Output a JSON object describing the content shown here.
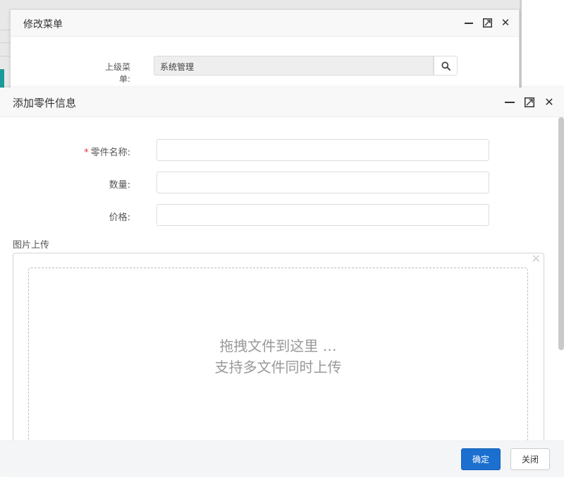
{
  "back_modal": {
    "title": "修改菜单",
    "parent_menu_label": "上级菜单:",
    "parent_menu_value": "系统管理"
  },
  "front_modal": {
    "title": "添加零件信息",
    "fields": [
      {
        "label": "零件名称:",
        "required": true,
        "value": ""
      },
      {
        "label": "数量:",
        "required": false,
        "value": ""
      },
      {
        "label": "价格:",
        "required": false,
        "value": ""
      }
    ],
    "upload": {
      "label": "图片上传",
      "drop_hint_line1": "拖拽文件到这里 …",
      "drop_hint_line2": "支持多文件同时上传"
    },
    "footer": {
      "confirm_label": "确定",
      "close_label": "关闭"
    }
  },
  "colors": {
    "primary_button": "#1b6fcf",
    "required_mark": "#e4393c",
    "accent_teal": "#1a9b9b"
  }
}
